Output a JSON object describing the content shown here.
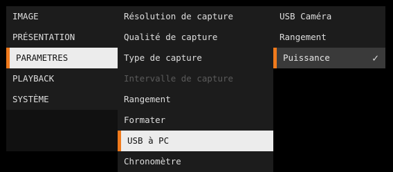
{
  "menu": {
    "categories": [
      {
        "label": "IMAGE"
      },
      {
        "label": "PRÉSENTATION"
      },
      {
        "label": "PARAMETRES"
      },
      {
        "label": "PLAYBACK"
      },
      {
        "label": "SYSTÈME"
      }
    ],
    "settings": [
      {
        "label": "Résolution de capture"
      },
      {
        "label": "Qualité de capture"
      },
      {
        "label": "Type de capture"
      },
      {
        "label": "Intervalle de capture"
      },
      {
        "label": "Rangement"
      },
      {
        "label": "Formater"
      },
      {
        "label": "USB à PC"
      },
      {
        "label": "Chronomètre"
      }
    ],
    "options": [
      {
        "label": "USB Caméra"
      },
      {
        "label": "Rangement"
      },
      {
        "label": "Puissance"
      }
    ],
    "selected_option_icon": "checkmark-icon",
    "check_glyph": "✓",
    "colors": {
      "accent": "#f07a1c",
      "highlight": "#ececec"
    }
  }
}
